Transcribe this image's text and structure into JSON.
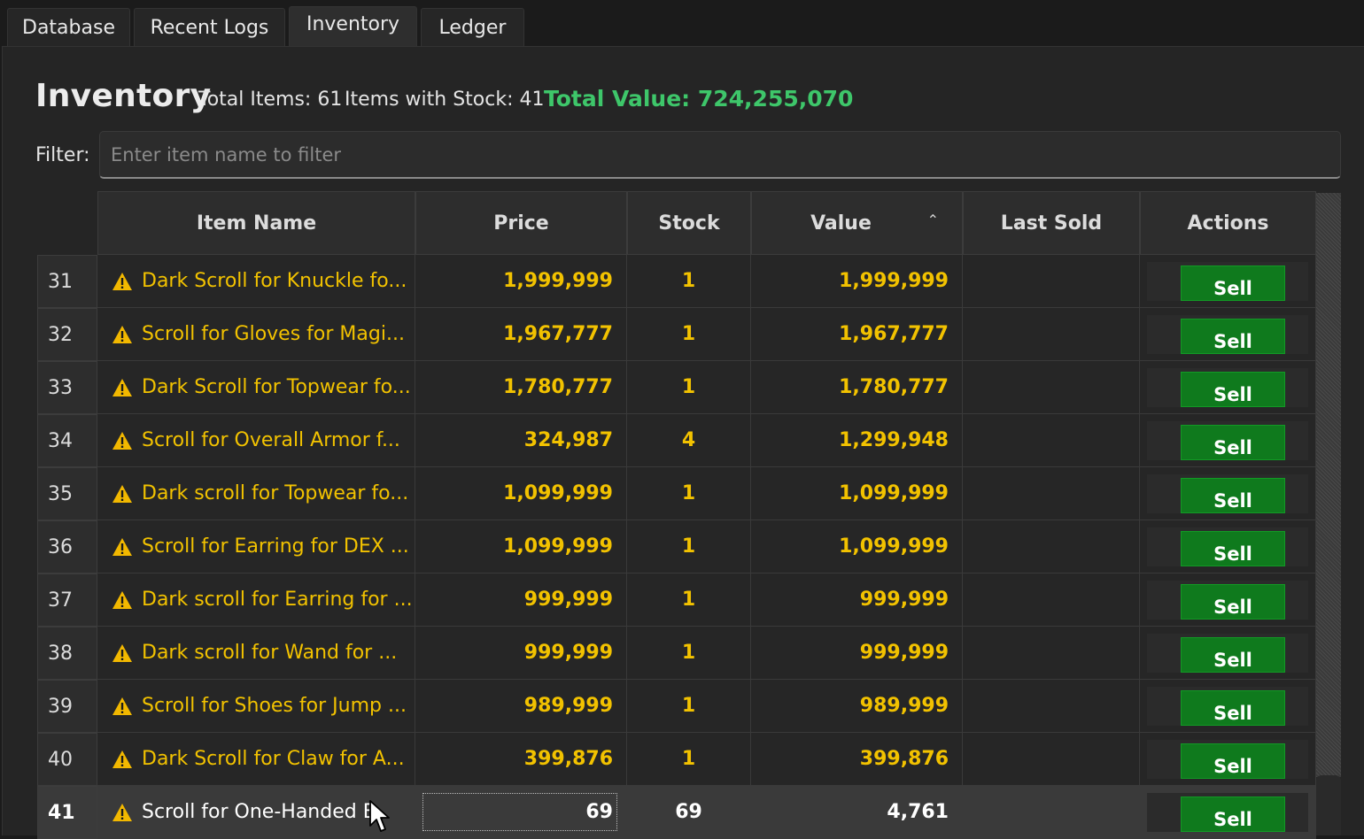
{
  "tabs": [
    {
      "label": "Database"
    },
    {
      "label": "Recent Logs"
    },
    {
      "label": "Inventory"
    },
    {
      "label": "Ledger"
    }
  ],
  "active_tab": "Inventory",
  "header": {
    "title": "Inventory",
    "total_items": "Total Items: 61",
    "items_with_stock": "Items with Stock: 41",
    "total_value": "Total Value: 724,255,070"
  },
  "filter": {
    "label": "Filter:",
    "placeholder": "Enter item name to filter",
    "value": ""
  },
  "columns": {
    "item_name": "Item Name",
    "price": "Price",
    "stock": "Stock",
    "value": "Value",
    "last_sold": "Last Sold",
    "actions": "Actions",
    "sorted_by": "Value"
  },
  "rows": [
    {
      "n": "31",
      "name": "Dark Scroll for Knuckle fo...",
      "price": "1,999,999",
      "stock": "1",
      "value": "1,999,999",
      "last_sold": "",
      "action": "Sell"
    },
    {
      "n": "32",
      "name": "Scroll for Gloves for Magi...",
      "price": "1,967,777",
      "stock": "1",
      "value": "1,967,777",
      "last_sold": "",
      "action": "Sell"
    },
    {
      "n": "33",
      "name": "Dark Scroll for Topwear fo...",
      "price": "1,780,777",
      "stock": "1",
      "value": "1,780,777",
      "last_sold": "",
      "action": "Sell"
    },
    {
      "n": "34",
      "name": "Scroll for Overall Armor f...",
      "price": "324,987",
      "stock": "4",
      "value": "1,299,948",
      "last_sold": "",
      "action": "Sell"
    },
    {
      "n": "35",
      "name": "Dark scroll for Topwear fo...",
      "price": "1,099,999",
      "stock": "1",
      "value": "1,099,999",
      "last_sold": "",
      "action": "Sell"
    },
    {
      "n": "36",
      "name": "Scroll for Earring for DEX ...",
      "price": "1,099,999",
      "stock": "1",
      "value": "1,099,999",
      "last_sold": "",
      "action": "Sell"
    },
    {
      "n": "37",
      "name": "Dark scroll for Earring for ...",
      "price": "999,999",
      "stock": "1",
      "value": "999,999",
      "last_sold": "",
      "action": "Sell"
    },
    {
      "n": "38",
      "name": "Dark scroll for Wand for ...",
      "price": "999,999",
      "stock": "1",
      "value": "999,999",
      "last_sold": "",
      "action": "Sell"
    },
    {
      "n": "39",
      "name": "Scroll for Shoes for Jump ...",
      "price": "989,999",
      "stock": "1",
      "value": "989,999",
      "last_sold": "",
      "action": "Sell"
    },
    {
      "n": "40",
      "name": "Dark Scroll for Claw for A...",
      "price": "399,876",
      "stock": "1",
      "value": "399,876",
      "last_sold": "",
      "action": "Sell"
    },
    {
      "n": "41",
      "name": "Scroll for One-Handed B",
      "price": "69",
      "stock": "69",
      "value": "4,761",
      "last_sold": "",
      "action": "Sell",
      "selected": true
    }
  ],
  "colors": {
    "warning_text": "#f2c200",
    "total_value": "#3ec66a",
    "sell_button": "#0f7a1d",
    "background": "#252525"
  },
  "icons": {
    "row_status": "warning-triangle-icon",
    "sort": "sort-ascending-icon",
    "pointer": "mouse-cursor-icon"
  }
}
